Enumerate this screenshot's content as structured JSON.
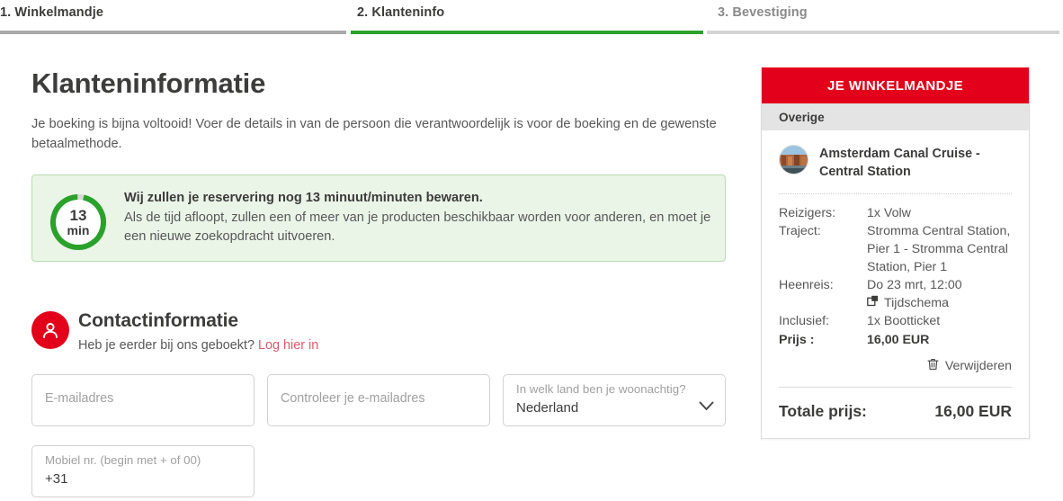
{
  "stepper": {
    "steps": [
      {
        "label": "1. Winkelmandje",
        "state": "completed",
        "bar_color": "#a9a9a9"
      },
      {
        "label": "2. Klanteninfo",
        "state": "active",
        "bar_color": "#2aa22a"
      },
      {
        "label": "3. Bevestiging",
        "state": "upcoming",
        "bar_color": "#d4d4d4"
      }
    ]
  },
  "main": {
    "title": "Klanteninformatie",
    "intro": "Je boeking is bijna voltooid! Voer de details in van de persoon die verantwoordelijk is voor de boeking en de gewenste betaalmethode.",
    "notice": {
      "timer_value": "13",
      "timer_unit": "min",
      "timer_percent_remaining": 96,
      "title": "Wij zullen je reservering nog 13 minuut/minuten bewaren.",
      "body": "Als de tijd afloopt, zullen een of meer van je producten beschikbaar worden voor anderen, en moet je een nieuwe zoekopdracht uitvoeren.",
      "bg_color": "#eaf4e7",
      "border_color": "#b9dcb0",
      "ring_color": "#2aa22a"
    },
    "contact": {
      "icon": "user-circle-icon",
      "title": "Contactinformatie",
      "question": "Heb je eerder bij ons geboekt?",
      "login_link": "Log hier in",
      "link_color": "#e05a6b"
    },
    "form": {
      "email": {
        "placeholder": "E-mailadres",
        "value": ""
      },
      "email_confirm": {
        "placeholder": "Controleer je e-mailadres",
        "value": ""
      },
      "country": {
        "placeholder": "In welk land ben je woonachtig?",
        "value": "Nederland",
        "options": [
          "Nederland"
        ]
      },
      "mobile": {
        "placeholder": "Mobiel nr. (begin met + of 00)",
        "value": "+31"
      }
    }
  },
  "cart": {
    "header": "JE WINKELMANDJE",
    "header_color": "#e2001a",
    "section_label": "Overige",
    "product": {
      "name": "Amsterdam Canal Cruise - Central Station",
      "thumbnail": "canal-photo-thumbnail"
    },
    "details": [
      {
        "label": "Reizigers:",
        "value": "1x Volw"
      },
      {
        "label": "Traject:",
        "value": "Stromma Central Station, Pier 1 - Stromma Central Station, Pier 1"
      },
      {
        "label": "Heenreis:",
        "value": "Do 23 mrt, 12:00"
      },
      {
        "label": "Inclusief:",
        "value": "1x Bootticket"
      }
    ],
    "schedule_link": {
      "label": "Tijdschema",
      "icon": "external-link-icon"
    },
    "price": {
      "label": "Prijs :",
      "value": "16,00 EUR"
    },
    "remove": {
      "label": "Verwijderen",
      "icon": "trash-icon"
    },
    "total": {
      "label": "Totale prijs:",
      "value": "16,00 EUR"
    }
  }
}
